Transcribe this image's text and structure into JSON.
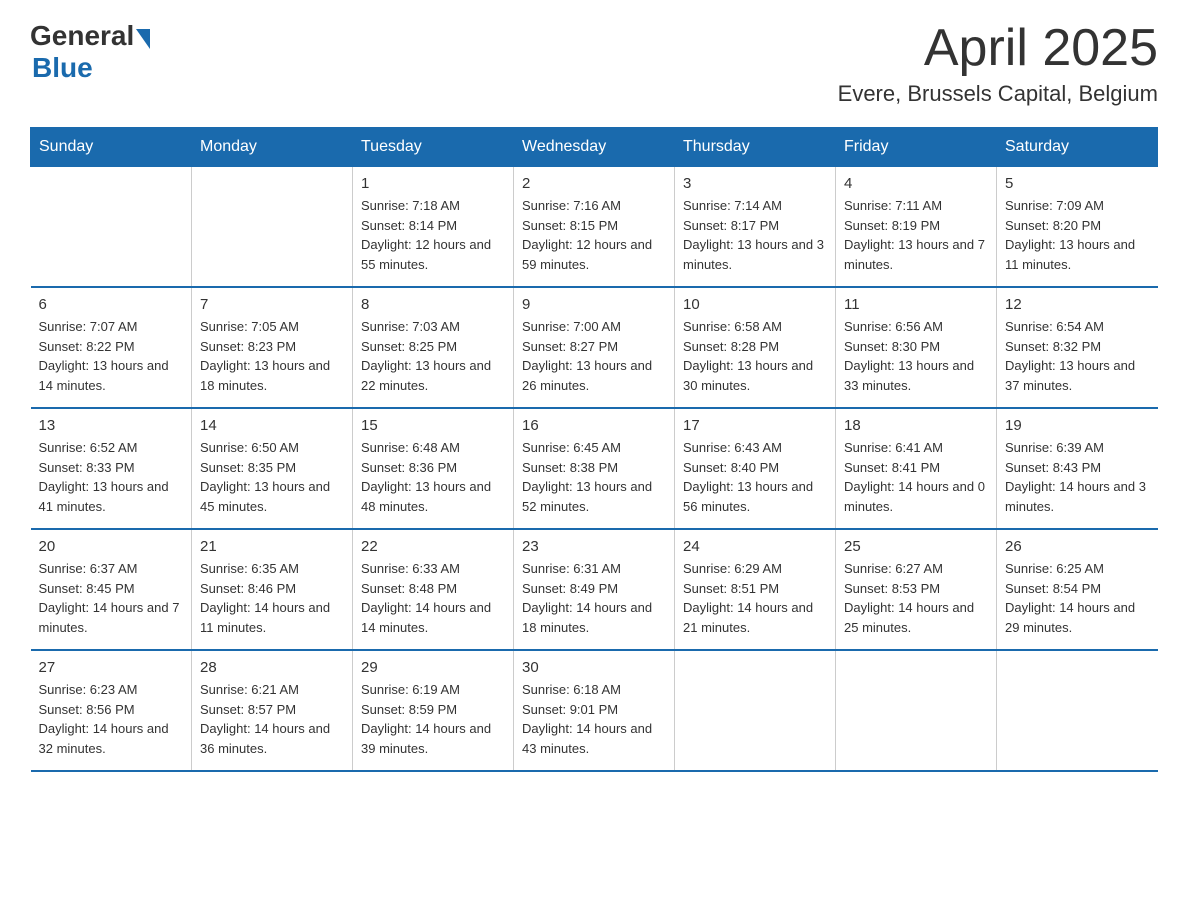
{
  "header": {
    "logo": {
      "general": "General",
      "blue": "Blue",
      "triangle": true
    },
    "title": "April 2025",
    "location": "Evere, Brussels Capital, Belgium"
  },
  "days_of_week": [
    "Sunday",
    "Monday",
    "Tuesday",
    "Wednesday",
    "Thursday",
    "Friday",
    "Saturday"
  ],
  "weeks": [
    [
      {
        "day": "",
        "sunrise": "",
        "sunset": "",
        "daylight": ""
      },
      {
        "day": "",
        "sunrise": "",
        "sunset": "",
        "daylight": ""
      },
      {
        "day": "1",
        "sunrise": "Sunrise: 7:18 AM",
        "sunset": "Sunset: 8:14 PM",
        "daylight": "Daylight: 12 hours and 55 minutes."
      },
      {
        "day": "2",
        "sunrise": "Sunrise: 7:16 AM",
        "sunset": "Sunset: 8:15 PM",
        "daylight": "Daylight: 12 hours and 59 minutes."
      },
      {
        "day": "3",
        "sunrise": "Sunrise: 7:14 AM",
        "sunset": "Sunset: 8:17 PM",
        "daylight": "Daylight: 13 hours and 3 minutes."
      },
      {
        "day": "4",
        "sunrise": "Sunrise: 7:11 AM",
        "sunset": "Sunset: 8:19 PM",
        "daylight": "Daylight: 13 hours and 7 minutes."
      },
      {
        "day": "5",
        "sunrise": "Sunrise: 7:09 AM",
        "sunset": "Sunset: 8:20 PM",
        "daylight": "Daylight: 13 hours and 11 minutes."
      }
    ],
    [
      {
        "day": "6",
        "sunrise": "Sunrise: 7:07 AM",
        "sunset": "Sunset: 8:22 PM",
        "daylight": "Daylight: 13 hours and 14 minutes."
      },
      {
        "day": "7",
        "sunrise": "Sunrise: 7:05 AM",
        "sunset": "Sunset: 8:23 PM",
        "daylight": "Daylight: 13 hours and 18 minutes."
      },
      {
        "day": "8",
        "sunrise": "Sunrise: 7:03 AM",
        "sunset": "Sunset: 8:25 PM",
        "daylight": "Daylight: 13 hours and 22 minutes."
      },
      {
        "day": "9",
        "sunrise": "Sunrise: 7:00 AM",
        "sunset": "Sunset: 8:27 PM",
        "daylight": "Daylight: 13 hours and 26 minutes."
      },
      {
        "day": "10",
        "sunrise": "Sunrise: 6:58 AM",
        "sunset": "Sunset: 8:28 PM",
        "daylight": "Daylight: 13 hours and 30 minutes."
      },
      {
        "day": "11",
        "sunrise": "Sunrise: 6:56 AM",
        "sunset": "Sunset: 8:30 PM",
        "daylight": "Daylight: 13 hours and 33 minutes."
      },
      {
        "day": "12",
        "sunrise": "Sunrise: 6:54 AM",
        "sunset": "Sunset: 8:32 PM",
        "daylight": "Daylight: 13 hours and 37 minutes."
      }
    ],
    [
      {
        "day": "13",
        "sunrise": "Sunrise: 6:52 AM",
        "sunset": "Sunset: 8:33 PM",
        "daylight": "Daylight: 13 hours and 41 minutes."
      },
      {
        "day": "14",
        "sunrise": "Sunrise: 6:50 AM",
        "sunset": "Sunset: 8:35 PM",
        "daylight": "Daylight: 13 hours and 45 minutes."
      },
      {
        "day": "15",
        "sunrise": "Sunrise: 6:48 AM",
        "sunset": "Sunset: 8:36 PM",
        "daylight": "Daylight: 13 hours and 48 minutes."
      },
      {
        "day": "16",
        "sunrise": "Sunrise: 6:45 AM",
        "sunset": "Sunset: 8:38 PM",
        "daylight": "Daylight: 13 hours and 52 minutes."
      },
      {
        "day": "17",
        "sunrise": "Sunrise: 6:43 AM",
        "sunset": "Sunset: 8:40 PM",
        "daylight": "Daylight: 13 hours and 56 minutes."
      },
      {
        "day": "18",
        "sunrise": "Sunrise: 6:41 AM",
        "sunset": "Sunset: 8:41 PM",
        "daylight": "Daylight: 14 hours and 0 minutes."
      },
      {
        "day": "19",
        "sunrise": "Sunrise: 6:39 AM",
        "sunset": "Sunset: 8:43 PM",
        "daylight": "Daylight: 14 hours and 3 minutes."
      }
    ],
    [
      {
        "day": "20",
        "sunrise": "Sunrise: 6:37 AM",
        "sunset": "Sunset: 8:45 PM",
        "daylight": "Daylight: 14 hours and 7 minutes."
      },
      {
        "day": "21",
        "sunrise": "Sunrise: 6:35 AM",
        "sunset": "Sunset: 8:46 PM",
        "daylight": "Daylight: 14 hours and 11 minutes."
      },
      {
        "day": "22",
        "sunrise": "Sunrise: 6:33 AM",
        "sunset": "Sunset: 8:48 PM",
        "daylight": "Daylight: 14 hours and 14 minutes."
      },
      {
        "day": "23",
        "sunrise": "Sunrise: 6:31 AM",
        "sunset": "Sunset: 8:49 PM",
        "daylight": "Daylight: 14 hours and 18 minutes."
      },
      {
        "day": "24",
        "sunrise": "Sunrise: 6:29 AM",
        "sunset": "Sunset: 8:51 PM",
        "daylight": "Daylight: 14 hours and 21 minutes."
      },
      {
        "day": "25",
        "sunrise": "Sunrise: 6:27 AM",
        "sunset": "Sunset: 8:53 PM",
        "daylight": "Daylight: 14 hours and 25 minutes."
      },
      {
        "day": "26",
        "sunrise": "Sunrise: 6:25 AM",
        "sunset": "Sunset: 8:54 PM",
        "daylight": "Daylight: 14 hours and 29 minutes."
      }
    ],
    [
      {
        "day": "27",
        "sunrise": "Sunrise: 6:23 AM",
        "sunset": "Sunset: 8:56 PM",
        "daylight": "Daylight: 14 hours and 32 minutes."
      },
      {
        "day": "28",
        "sunrise": "Sunrise: 6:21 AM",
        "sunset": "Sunset: 8:57 PM",
        "daylight": "Daylight: 14 hours and 36 minutes."
      },
      {
        "day": "29",
        "sunrise": "Sunrise: 6:19 AM",
        "sunset": "Sunset: 8:59 PM",
        "daylight": "Daylight: 14 hours and 39 minutes."
      },
      {
        "day": "30",
        "sunrise": "Sunrise: 6:18 AM",
        "sunset": "Sunset: 9:01 PM",
        "daylight": "Daylight: 14 hours and 43 minutes."
      },
      {
        "day": "",
        "sunrise": "",
        "sunset": "",
        "daylight": ""
      },
      {
        "day": "",
        "sunrise": "",
        "sunset": "",
        "daylight": ""
      },
      {
        "day": "",
        "sunrise": "",
        "sunset": "",
        "daylight": ""
      }
    ]
  ]
}
